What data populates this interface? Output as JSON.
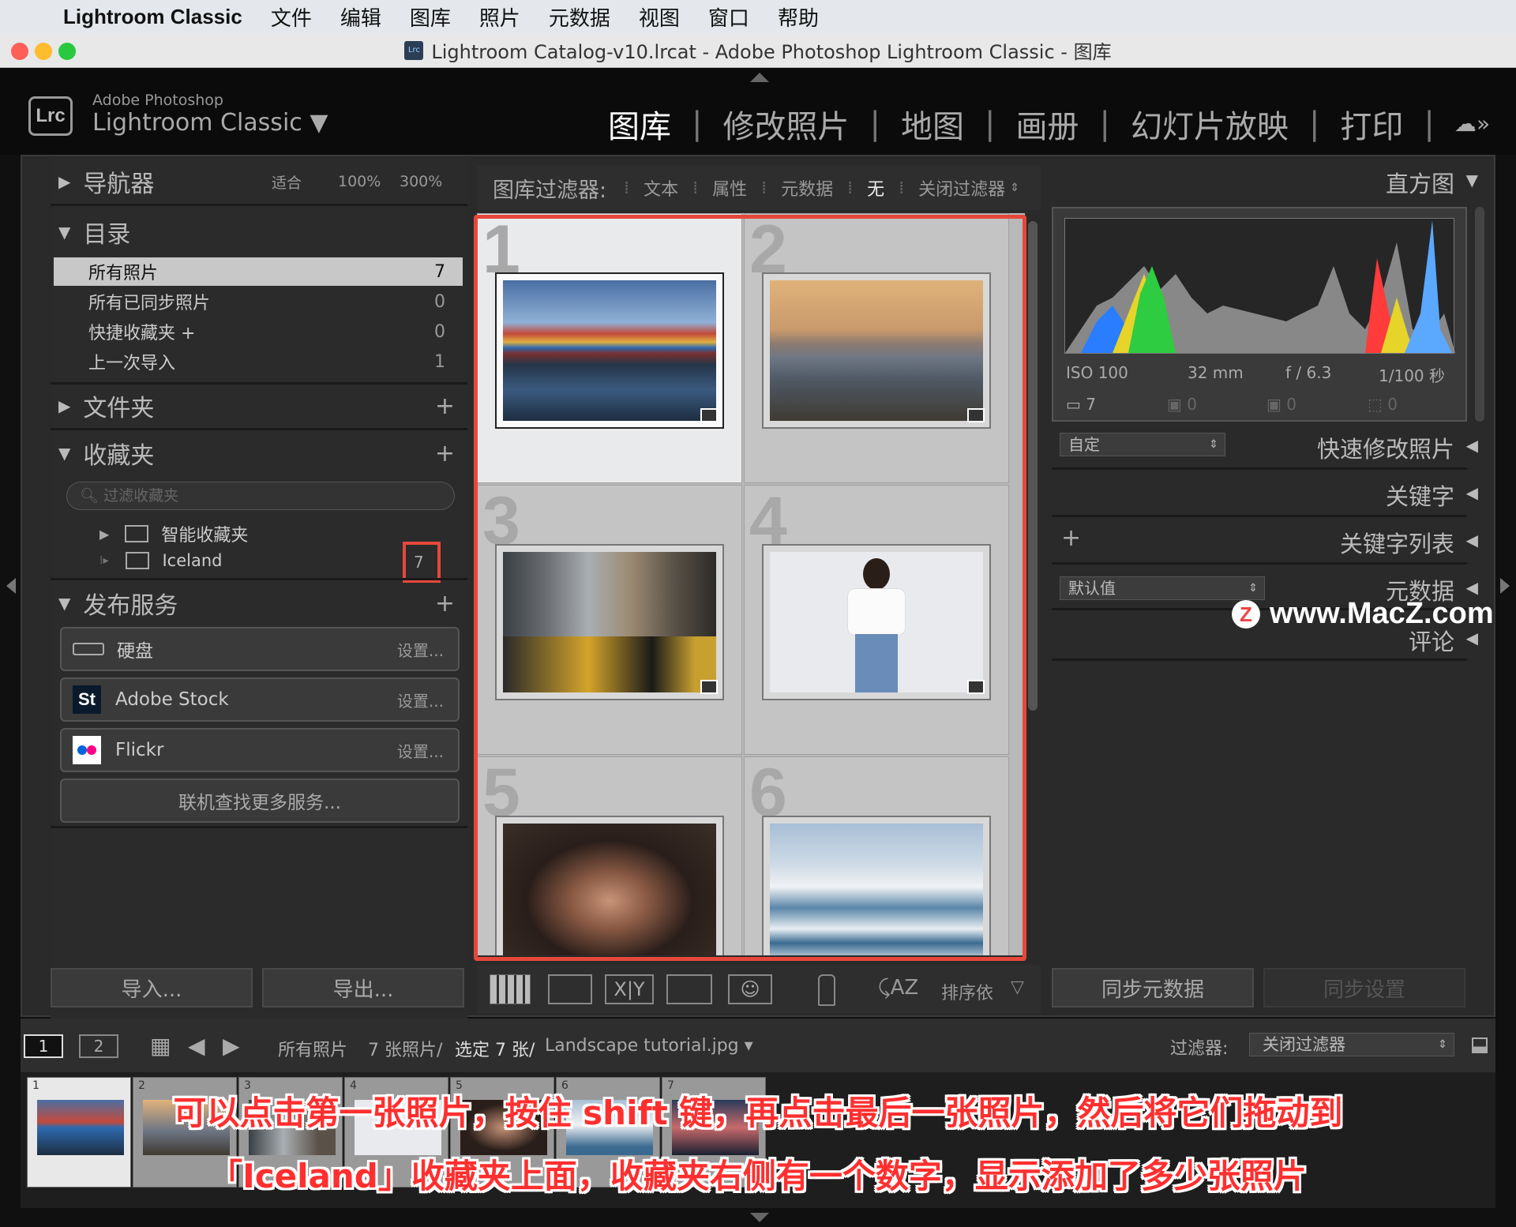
{
  "menubar": {
    "app": "Lightroom Classic",
    "items": [
      "文件",
      "编辑",
      "图库",
      "照片",
      "元数据",
      "视图",
      "窗口",
      "帮助"
    ]
  },
  "window": {
    "title": "Lightroom Catalog-v10.lrcat - Adobe Photoshop Lightroom Classic - 图库"
  },
  "brand": {
    "badge": "Lrc",
    "top": "Adobe Photoshop",
    "main": "Lightroom Classic"
  },
  "modules": [
    "图库",
    "修改照片",
    "地图",
    "画册",
    "幻灯片放映",
    "打印"
  ],
  "left": {
    "navigator": {
      "title": "导航器",
      "fit": "适合",
      "z100": "100%",
      "z300": "300%"
    },
    "catalog": {
      "title": "目录",
      "rows": [
        {
          "label": "所有照片",
          "count": "7"
        },
        {
          "label": "所有已同步照片",
          "count": "0"
        },
        {
          "label": "快捷收藏夹 +",
          "count": "0"
        },
        {
          "label": "上一次导入",
          "count": "1"
        }
      ]
    },
    "folders": {
      "title": "文件夹"
    },
    "collections": {
      "title": "收藏夹",
      "search_placeholder": "过滤收藏夹",
      "smart": "智能收藏夹",
      "iceland": "Iceland",
      "iceland_count": "7"
    },
    "publish": {
      "title": "发布服务",
      "services": [
        {
          "name": "硬盘",
          "setup": "设置..."
        },
        {
          "name": "Adobe Stock",
          "setup": "设置..."
        },
        {
          "name": "Flickr",
          "setup": "设置..."
        }
      ],
      "more": "联机查找更多服务..."
    },
    "import_btn": "导入...",
    "export_btn": "导出..."
  },
  "filter": {
    "label": "图库过滤器:",
    "text": "文本",
    "attr": "属性",
    "meta": "元数据",
    "none": "无",
    "off": "关闭过滤器"
  },
  "grid": {
    "cells": [
      "1",
      "2",
      "3",
      "4",
      "5",
      "6"
    ]
  },
  "toolbar": {
    "sort": "排序依"
  },
  "right": {
    "histogram": {
      "title": "直方图",
      "iso": "ISO 100",
      "focal": "32 mm",
      "aperture": "f / 6.3",
      "shutter": "1/100 秒",
      "c1": "7",
      "c2": "0",
      "c3": "0",
      "c4": "0"
    },
    "quick": {
      "preset": "自定",
      "title": "快速修改照片"
    },
    "keywords": "关键字",
    "keyword_list": "关键字列表",
    "metadata": {
      "preset": "默认值",
      "title": "元数据"
    },
    "comments": "评论",
    "sync_meta": "同步元数据",
    "sync_settings": "同步设置"
  },
  "status": {
    "page1": "1",
    "page2": "2",
    "source": "所有照片",
    "count": "7 张照片/",
    "selected": "选定 7 张/",
    "file": "Landscape tutorial.jpg",
    "filter_label": "过滤器:",
    "filter_value": "关闭过滤器"
  },
  "filmstrip": [
    "1",
    "2",
    "3",
    "4",
    "5",
    "6",
    "7"
  ],
  "caption": {
    "line1": "可以点击第一张照片，按住 shift 键，再点击最后一张照片，然后将它们拖动到",
    "line2": "「Iceland」收藏夹上面，收藏夹右侧有一个数字，显示添加了多少张照片"
  },
  "watermark": "www.MacZ.com",
  "colors": {
    "highlight": "#e5483b",
    "caption": "#ff2f2f"
  }
}
